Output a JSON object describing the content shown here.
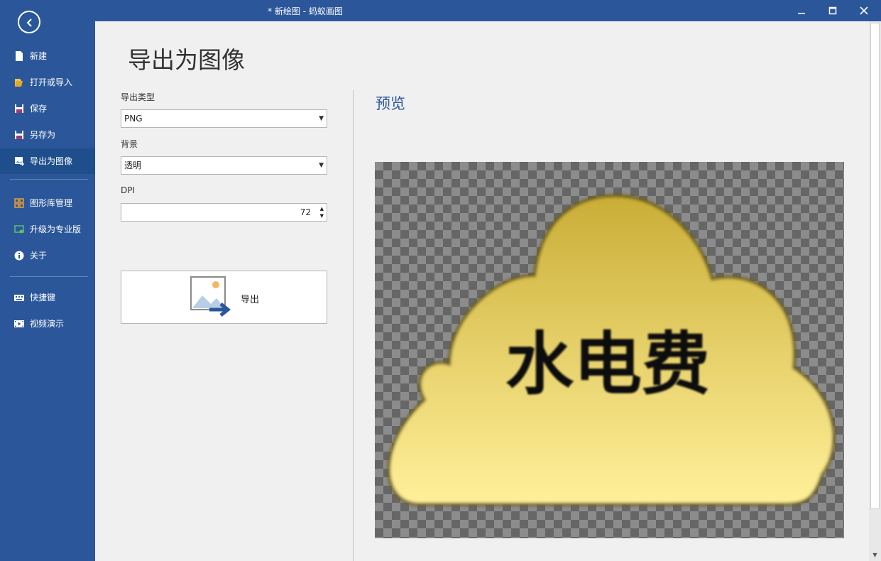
{
  "window": {
    "title": "* 新绘图 - 蚂蚁画图",
    "minimize": "—",
    "maximize": "☐",
    "close": "✕"
  },
  "sidebar": {
    "items": [
      {
        "label": "新建",
        "icon": "new-file-icon"
      },
      {
        "label": "打开或导入",
        "icon": "open-folder-icon"
      },
      {
        "label": "保存",
        "icon": "save-icon"
      },
      {
        "label": "另存为",
        "icon": "save-as-icon"
      },
      {
        "label": "导出为图像",
        "icon": "export-image-icon",
        "active": true
      },
      {
        "label": "图形库管理",
        "icon": "library-icon"
      },
      {
        "label": "升级为专业版",
        "icon": "upgrade-icon"
      },
      {
        "label": "关于",
        "icon": "info-icon"
      },
      {
        "label": "快捷键",
        "icon": "keyboard-icon"
      },
      {
        "label": "视频演示",
        "icon": "video-icon"
      }
    ]
  },
  "main": {
    "title": "导出为图像",
    "export_type_label": "导出类型",
    "export_type_value": "PNG",
    "background_label": "背景",
    "background_value": "透明",
    "dpi_label": "DPI",
    "dpi_value": "72",
    "export_button_label": "导出",
    "preview_title": "预览",
    "preview_text": "水电费"
  },
  "colors": {
    "accent": "#2b579a",
    "cloud_top": "#d0b440",
    "cloud_bottom": "#fff09a"
  }
}
